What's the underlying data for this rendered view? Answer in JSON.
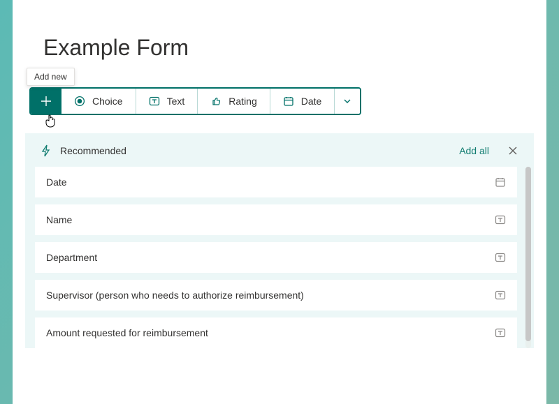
{
  "form": {
    "title": "Example Form"
  },
  "tooltip": "Add new",
  "toolbar": {
    "choice": "Choice",
    "text": "Text",
    "rating": "Rating",
    "date": "Date"
  },
  "recommended": {
    "title": "Recommended",
    "add_all": "Add all",
    "items": [
      {
        "label": "Date",
        "type": "date"
      },
      {
        "label": "Name",
        "type": "text"
      },
      {
        "label": "Department",
        "type": "text"
      },
      {
        "label": "Supervisor (person who needs to authorize reimbursement)",
        "type": "text"
      },
      {
        "label": "Amount requested for reimbursement",
        "type": "text"
      }
    ]
  }
}
